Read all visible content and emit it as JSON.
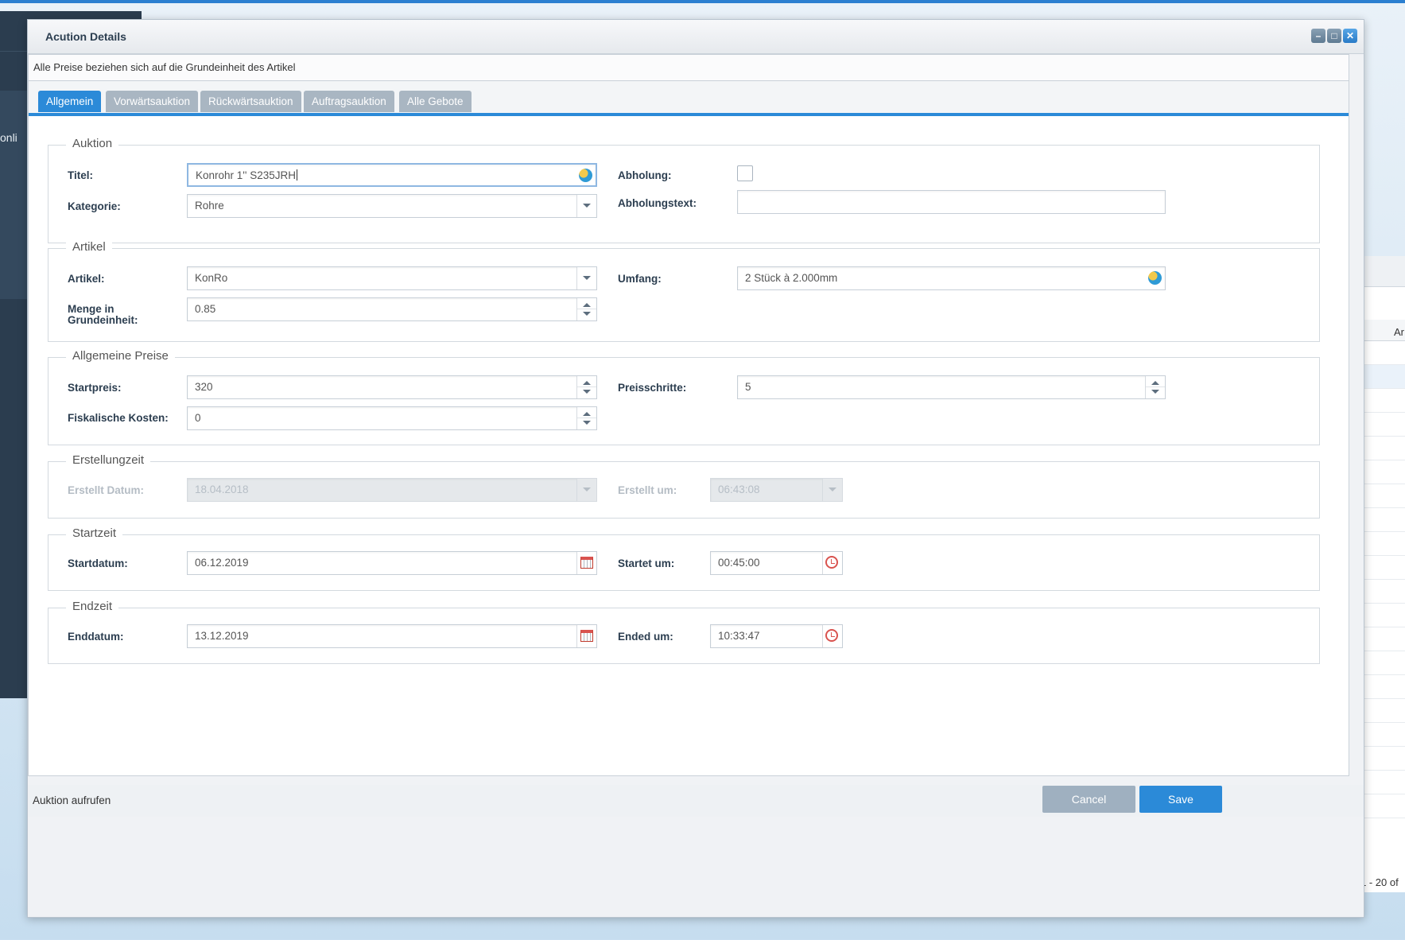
{
  "background": {
    "sidebar_text": "onli",
    "grid_column_label": "Ar",
    "grid_pager_text": "1 - 20 of"
  },
  "window": {
    "title": "Acution Details",
    "tools": [
      "minimize-icon",
      "maximize-icon",
      "close-icon"
    ],
    "info_text": "Alle Preise beziehen sich auf die Grundeinheit des Artikel"
  },
  "tabs": [
    {
      "label": "Allgemein",
      "active": true
    },
    {
      "label": "Vorwärtsauktion",
      "active": false
    },
    {
      "label": "Rückwärtsauktion",
      "active": false
    },
    {
      "label": "Auftragsauktion",
      "active": false
    },
    {
      "label": "Alle Gebote",
      "active": false
    }
  ],
  "auktion": {
    "legend": "Auktion",
    "titel_label": "Titel:",
    "titel_value": "Konrohr 1'' S235JRH",
    "kategorie_label": "Kategorie:",
    "kategorie_value": "Rohre",
    "abholung_label": "Abholung:",
    "abholung_checked": false,
    "abholungstext_label": "Abholungstext:",
    "abholungstext_value": ""
  },
  "artikel": {
    "legend": "Artikel",
    "artikel_label": "Artikel:",
    "artikel_value": "KonRo",
    "menge_label_1": "Menge in",
    "menge_label_2": "Grundeinheit:",
    "menge_value": "0.85",
    "umfang_label": "Umfang:",
    "umfang_value": "2 Stück à 2.000mm"
  },
  "preise": {
    "legend": "Allgemeine Preise",
    "startpreis_label": "Startpreis:",
    "startpreis_value": "320",
    "fiskal_label": "Fiskalische Kosten:",
    "fiskal_value": "0",
    "preisschritte_label": "Preisschritte:",
    "preisschritte_value": "5"
  },
  "erstellung": {
    "legend": "Erstellungzeit",
    "datum_label": "Erstellt Datum:",
    "datum_value": "18.04.2018",
    "um_label": "Erstellt um:",
    "um_value": "06:43:08"
  },
  "startzeit": {
    "legend": "Startzeit",
    "datum_label": "Startdatum:",
    "datum_value": "06.12.2019",
    "um_label": "Startet um:",
    "um_value": "00:45:00"
  },
  "endzeit": {
    "legend": "Endzeit",
    "datum_label": "Enddatum:",
    "datum_value": "13.12.2019",
    "um_label": "Ended um:",
    "um_value": "10:33:47"
  },
  "footer": {
    "status": "Auktion aufrufen",
    "cancel_label": "Cancel",
    "save_label": "Save"
  },
  "colors": {
    "accent": "#2b8ad8",
    "tab_inactive": "#a9b6c2",
    "cancel_button": "#9fb0c0",
    "sidebar": "#2b3d4f"
  }
}
